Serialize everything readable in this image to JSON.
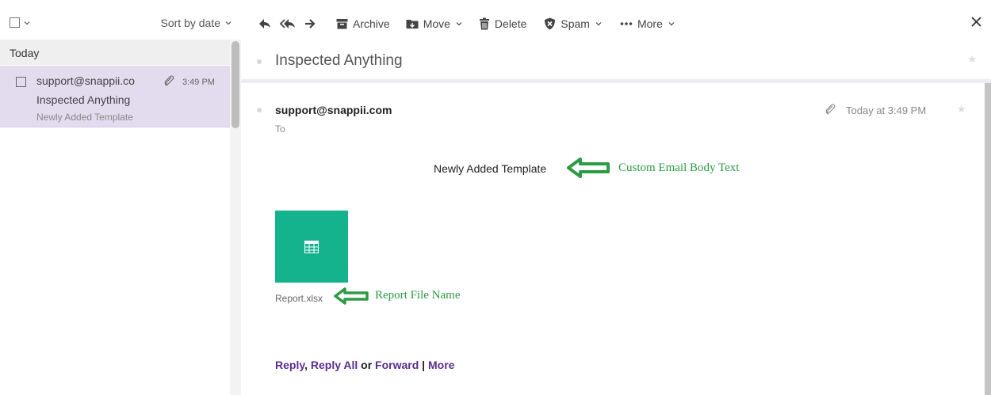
{
  "list_header": {
    "sort_label": "Sort by date",
    "chevron_icon": "chevron-down-icon"
  },
  "toolbar": {
    "reply_icon": "reply-icon",
    "reply_all_icon": "reply-all-icon",
    "forward_icon": "forward-icon",
    "archive_label": "Archive",
    "move_label": "Move",
    "delete_label": "Delete",
    "spam_label": "Spam",
    "more_label": "More",
    "close_icon": "close-icon"
  },
  "message_list": {
    "group_label": "Today",
    "items": [
      {
        "from": "support@snappii.co",
        "time": "3:49 PM",
        "subject": "Inspected Anything",
        "preview": "Newly Added Template",
        "has_attachment": true
      }
    ]
  },
  "message": {
    "subject": "Inspected Anything",
    "from": "support@snappii.com",
    "to_label": "To",
    "timestamp": "Today at 3:49 PM",
    "body": "Newly Added Template",
    "attachment": {
      "name": "Report.xlsx",
      "tile_color": "#14b38d",
      "icon": "spreadsheet-icon"
    },
    "actions": {
      "reply": "Reply",
      "comma": ",",
      "reply_all": "Reply All",
      "or": "or",
      "forward": "Forward",
      "pipe": "|",
      "more": "More"
    }
  },
  "annotations": {
    "body_note": "Custom Email Body Text",
    "file_note": "Report File Name",
    "color": "#2d9a44"
  },
  "colors": {
    "selected_row": "#e3dcee",
    "link": "#5a2e8f"
  }
}
